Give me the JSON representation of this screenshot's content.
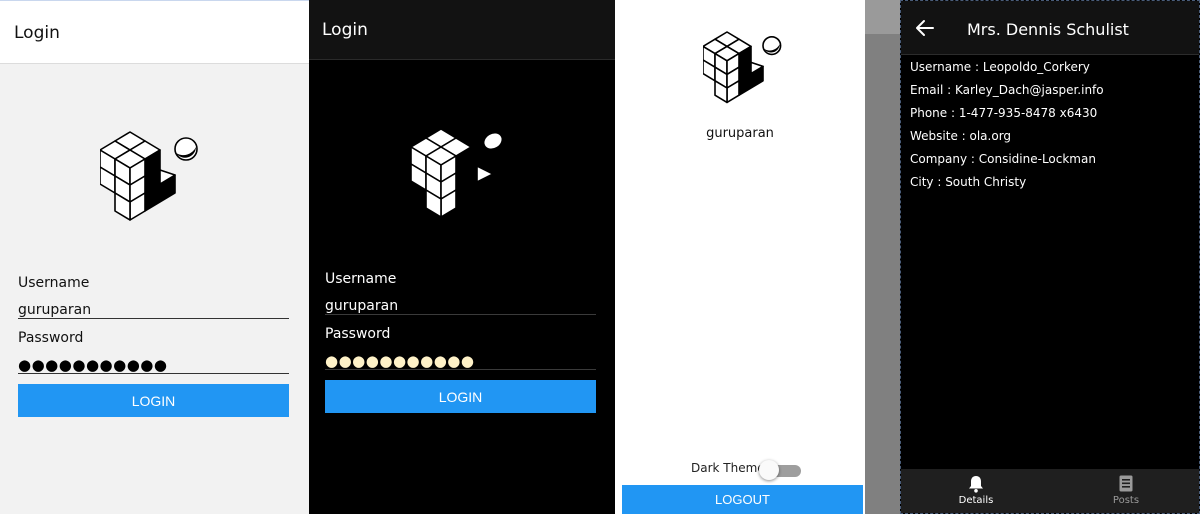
{
  "light_login": {
    "header_title": "Login",
    "username_label": "Username",
    "username_value": "guruparan",
    "password_label": "Password",
    "password_masked": "●●●●●●●●●●●",
    "login_button": "LOGIN"
  },
  "dark_login": {
    "header_title": "Login",
    "username_label": "Username",
    "username_value": "guruparan",
    "password_label": "Password",
    "password_masked": "●●●●●●●●●●●",
    "login_button": "LOGIN"
  },
  "profile": {
    "username": "guruparan",
    "theme_label": "Dark Theme",
    "dark_theme_enabled": false,
    "logout_button": "LOGOUT"
  },
  "details_screen": {
    "header_title": "Mrs. Dennis Schulist",
    "back_icon": "arrow-left-icon",
    "rows": [
      "Username : Leopoldo_Corkery",
      "Email : Karley_Dach@jasper.info",
      "Phone : 1-477-935-8478 x6430",
      "Website : ola.org",
      "Company : Considine-Lockman",
      "City : South Christy"
    ],
    "bottom_nav": [
      {
        "label": "Details",
        "icon": "bell-icon",
        "active": true
      },
      {
        "label": "Posts",
        "icon": "document-icon",
        "active": false
      }
    ]
  },
  "colors": {
    "accent": "#2196f3",
    "light_background": "#f2f2f2",
    "dark_background": "#000000",
    "dark_header": "#121212",
    "password_dots_dark": "#fff2c8"
  }
}
